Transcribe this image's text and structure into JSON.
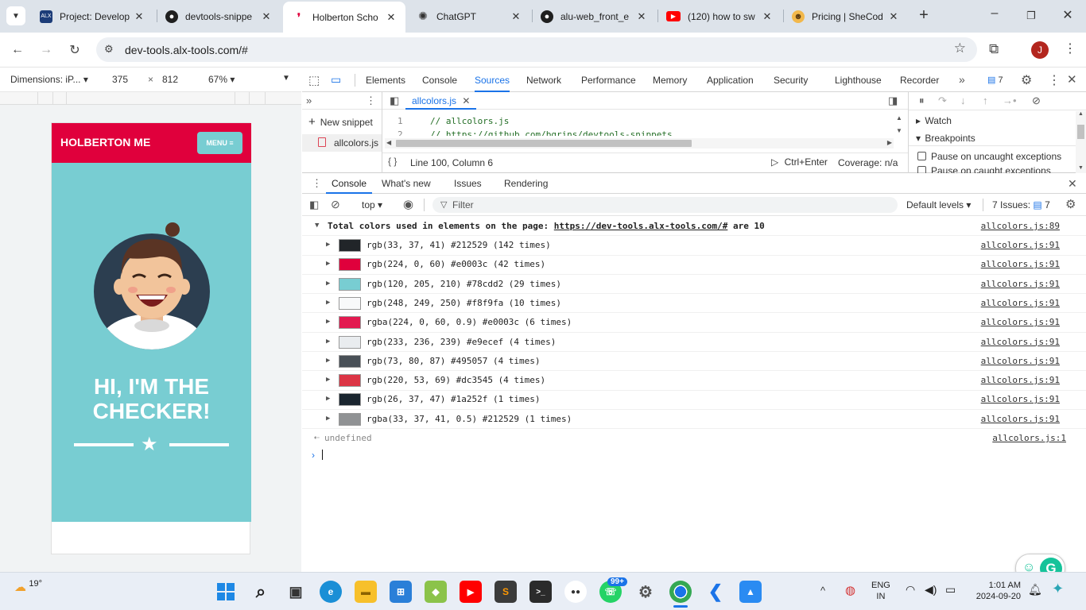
{
  "tabs": [
    {
      "title": "Project: Develop",
      "icon": "alx-icon",
      "active": false
    },
    {
      "title": "devtools-snippe",
      "icon": "github-icon",
      "active": false
    },
    {
      "title": "Holberton Scho",
      "icon": "holberton-icon",
      "active": true
    },
    {
      "title": "ChatGPT",
      "icon": "chatgpt-icon",
      "active": false
    },
    {
      "title": "alu-web_front_e",
      "icon": "github-icon",
      "active": false
    },
    {
      "title": "(120) how to sw",
      "icon": "youtube-icon",
      "active": false
    },
    {
      "title": "Pricing | SheCod",
      "icon": "shecodes-icon",
      "active": false
    }
  ],
  "browser": {
    "url": "dev-tools.alx-tools.com/#",
    "profile_initial": "J"
  },
  "device_toolbar": {
    "dimensions": "Dimensions: iP...",
    "width": "375",
    "height": "812",
    "zoom": "67%"
  },
  "phone": {
    "brand": "HOLBERTON ME",
    "menu": "MENU",
    "hero_line1": "HI, I'M THE",
    "hero_line2": "CHECKER!"
  },
  "devtools": {
    "tabs": [
      "Elements",
      "Console",
      "Sources",
      "Network",
      "Performance",
      "Memory",
      "Application",
      "Security",
      "Lighthouse",
      "Recorder"
    ],
    "selected_tab": "Sources",
    "issues_badge": "7",
    "sources": {
      "new_snippet": "New snippet",
      "snippet_file": "allcolors.js",
      "open_file": "allcolors.js",
      "code_lines": [
        {
          "num": "1",
          "text": "// allcolors.js"
        },
        {
          "num": "2",
          "text": "// https://github.com/bgrins/devtools-snippets"
        }
      ],
      "cursor_position": "Line 100, Column 6",
      "run_hint": "Ctrl+Enter",
      "coverage": "Coverage: n/a",
      "watch": "Watch",
      "breakpoints": "Breakpoints",
      "pause_uncaught": "Pause on uncaught exceptions",
      "pause_caught": "Pause on caught exceptions"
    },
    "drawer_tabs": [
      "Console",
      "What's new",
      "Issues",
      "Rendering"
    ],
    "console": {
      "context": "top",
      "filter_placeholder": "Filter",
      "levels": "Default levels",
      "issues": "7 Issues:",
      "issues_count": "7",
      "summary_prefix": "Total colors used in elements on the page:",
      "summary_url": "https://dev-tools.alx-tools.com/#",
      "summary_suffix": "are 10",
      "summary_source": "allcolors.js:89",
      "rows": [
        {
          "text": "rgb(33, 37, 41) #212529 (142 times)",
          "color": "#212529",
          "source": "allcolors.js:91"
        },
        {
          "text": "rgb(224, 0, 60) #e0003c (42 times)",
          "color": "#e0003c",
          "source": "allcolors.js:91"
        },
        {
          "text": "rgb(120, 205, 210) #78cdd2 (29 times)",
          "color": "#78cdd2",
          "source": "allcolors.js:91"
        },
        {
          "text": "rgb(248, 249, 250) #f8f9fa (10 times)",
          "color": "#f8f9fa",
          "source": "allcolors.js:91"
        },
        {
          "text": "rgba(224, 0, 60, 0.9) #e0003c (6 times)",
          "color": "#e31a50",
          "source": "allcolors.js:91"
        },
        {
          "text": "rgb(233, 236, 239) #e9ecef (4 times)",
          "color": "#e9ecef",
          "source": "allcolors.js:91"
        },
        {
          "text": "rgb(73, 80, 87) #495057 (4 times)",
          "color": "#495057",
          "source": "allcolors.js:91"
        },
        {
          "text": "rgb(220, 53, 69) #dc3545 (4 times)",
          "color": "#dc3545",
          "source": "allcolors.js:91"
        },
        {
          "text": "rgb(26, 37, 47) #1a252f (1 times)",
          "color": "#1a252f",
          "source": "allcolors.js:91"
        },
        {
          "text": "rgba(33, 37, 41, 0.5) #212529 (1 times)",
          "color": "#909294",
          "source": "allcolors.js:91"
        }
      ],
      "return_value": "undefined",
      "return_source": "allcolors.js:1"
    }
  },
  "taskbar": {
    "weather": "19°",
    "chrome_badge": "99+",
    "lang1": "ENG",
    "lang2": "IN",
    "time": "1:01 AM",
    "date": "2024-09-20"
  },
  "colors": {
    "brand_red": "#e0003c",
    "teal": "#78cdd2",
    "devtools_blue": "#1a73e8"
  }
}
